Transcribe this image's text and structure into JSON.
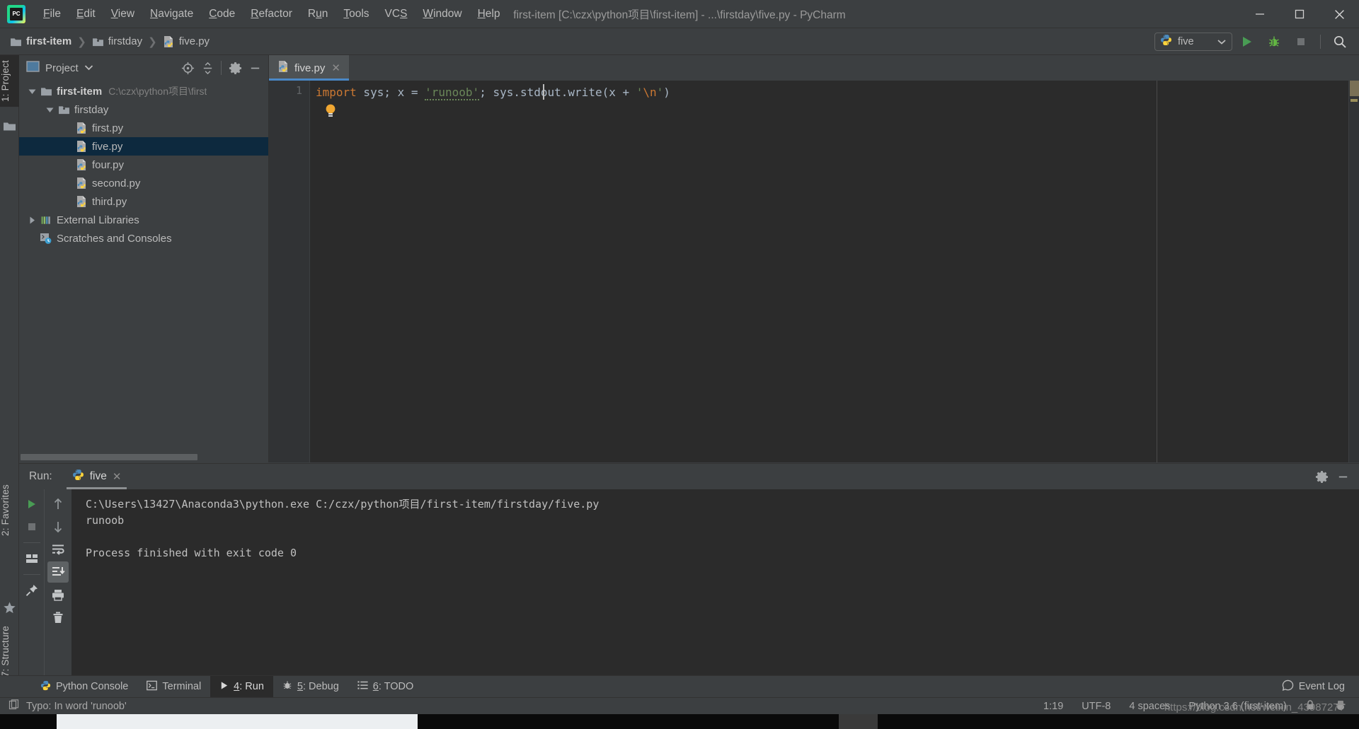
{
  "window": {
    "title": "first-item [C:\\czx\\python项目\\first-item] - ...\\firstday\\five.py - PyCharm",
    "minimize_label": "Minimize",
    "maximize_label": "Maximize",
    "close_label": "Close"
  },
  "menu": [
    {
      "label": "File",
      "mnemonic": "F"
    },
    {
      "label": "Edit",
      "mnemonic": "E"
    },
    {
      "label": "View",
      "mnemonic": "V"
    },
    {
      "label": "Navigate",
      "mnemonic": "N"
    },
    {
      "label": "Code",
      "mnemonic": "C"
    },
    {
      "label": "Refactor",
      "mnemonic": "R"
    },
    {
      "label": "Run",
      "mnemonic": "u"
    },
    {
      "label": "Tools",
      "mnemonic": "T"
    },
    {
      "label": "VCS",
      "mnemonic": "S"
    },
    {
      "label": "Window",
      "mnemonic": "W"
    },
    {
      "label": "Help",
      "mnemonic": "H"
    }
  ],
  "breadcrumbs": [
    {
      "label": "first-item",
      "icon": "folder-icon",
      "bold": true
    },
    {
      "label": "firstday",
      "icon": "folder-source-icon",
      "bold": false
    },
    {
      "label": "five.py",
      "icon": "python-file-icon",
      "bold": false
    }
  ],
  "toolbar": {
    "run_config": "five",
    "run_config_icon": "python-icon",
    "dropdown_icon": "chevron-down-icon",
    "run_button": "Run",
    "debug_button": "Debug",
    "stop_button": "Stop",
    "search_button": "Search Everywhere"
  },
  "left_strip": [
    {
      "label": "1: Project",
      "mnemonic": "1",
      "active": true,
      "icon": "project-icon"
    },
    {
      "label": "2: Favorites",
      "mnemonic": "2",
      "active": false,
      "icon": "star-icon"
    },
    {
      "label": "7: Structure",
      "mnemonic": "7",
      "active": false,
      "icon": "structure-icon"
    }
  ],
  "project_panel": {
    "title": "Project",
    "title_icon": "project-window-icon",
    "dropdown_icon": "chevron-down-icon",
    "actions": [
      {
        "name": "locate-icon",
        "tooltip": "Select Opened File"
      },
      {
        "name": "collapse-all-icon",
        "tooltip": "Collapse All"
      },
      {
        "name": "gear-icon",
        "tooltip": "Settings"
      },
      {
        "name": "minimize-icon",
        "tooltip": "Hide"
      }
    ],
    "tree": [
      {
        "label": "first-item",
        "path": "C:\\czx\\python项目\\first",
        "icon": "folder-icon",
        "depth": 0,
        "expanded": true,
        "bold": true,
        "selected": false
      },
      {
        "label": "firstday",
        "icon": "folder-source-icon",
        "depth": 1,
        "expanded": true,
        "bold": false,
        "selected": false
      },
      {
        "label": "first.py",
        "icon": "python-file-icon",
        "depth": 2,
        "expanded": null,
        "bold": false,
        "selected": false
      },
      {
        "label": "five.py",
        "icon": "python-file-icon",
        "depth": 2,
        "expanded": null,
        "bold": false,
        "selected": true
      },
      {
        "label": "four.py",
        "icon": "python-file-icon",
        "depth": 2,
        "expanded": null,
        "bold": false,
        "selected": false
      },
      {
        "label": "second.py",
        "icon": "python-file-icon",
        "depth": 2,
        "expanded": null,
        "bold": false,
        "selected": false
      },
      {
        "label": "third.py",
        "icon": "python-file-icon",
        "depth": 2,
        "expanded": null,
        "bold": false,
        "selected": false
      },
      {
        "label": "External Libraries",
        "icon": "libraries-icon",
        "depth": 0,
        "expanded": false,
        "bold": false,
        "selected": false
      },
      {
        "label": "Scratches and Consoles",
        "icon": "scratches-icon",
        "depth": 0,
        "expanded": null,
        "bold": false,
        "selected": false
      }
    ]
  },
  "editor": {
    "tab": {
      "label": "five.py",
      "icon": "python-file-icon",
      "close_icon": "close-icon"
    },
    "line_number": "1",
    "code_tokens": [
      {
        "text": "import",
        "kind": "keyword"
      },
      {
        "text": " sys; x = ",
        "kind": "plain"
      },
      {
        "text": "'runoob'",
        "kind": "string-typo"
      },
      {
        "text": "; sys.stdout.write(x + ",
        "kind": "plain"
      },
      {
        "text": "'",
        "kind": "string"
      },
      {
        "text": "\\n",
        "kind": "escape"
      },
      {
        "text": "'",
        "kind": "string"
      },
      {
        "text": ")",
        "kind": "plain"
      }
    ],
    "code_plain": "import sys; x = 'runoob'; sys.stdout.write(x + '\\n')",
    "intention_icon": "lightbulb-icon"
  },
  "run_panel": {
    "label": "Run:",
    "tab": {
      "label": "five",
      "icon": "python-icon",
      "close_icon": "close-icon"
    },
    "header_actions": [
      {
        "name": "gear-icon",
        "tooltip": "Settings"
      },
      {
        "name": "minimize-icon",
        "tooltip": "Hide"
      }
    ],
    "left_actions": [
      {
        "name": "rerun-icon",
        "tooltip": "Rerun"
      },
      {
        "name": "stop-icon",
        "tooltip": "Stop"
      },
      {
        "name": "layout-icon",
        "tooltip": "Layout"
      },
      {
        "name": "pin-icon",
        "tooltip": "Pin Tab"
      }
    ],
    "right_actions": [
      {
        "name": "arrow-up-icon",
        "tooltip": "Up the Stack Trace"
      },
      {
        "name": "arrow-down-icon",
        "tooltip": "Down the Stack Trace"
      },
      {
        "name": "soft-wrap-icon",
        "tooltip": "Use Soft Wraps"
      },
      {
        "name": "scroll-to-end-icon",
        "tooltip": "Scroll to End",
        "active": true
      },
      {
        "name": "print-icon",
        "tooltip": "Print"
      },
      {
        "name": "trash-icon",
        "tooltip": "Clear All"
      }
    ],
    "console_lines": [
      "C:\\Users\\13427\\Anaconda3\\python.exe C:/czx/python项目/first-item/firstday/five.py",
      "runoob",
      "",
      "Process finished with exit code 0"
    ]
  },
  "bottom_tabs": [
    {
      "label": "Python Console",
      "icon": "python-icon",
      "active": false,
      "mnemonic": ""
    },
    {
      "label": "Terminal",
      "icon": "terminal-icon",
      "active": false,
      "mnemonic": ""
    },
    {
      "label": "4: Run",
      "icon": "play-icon",
      "active": true,
      "mnemonic": "4"
    },
    {
      "label": "5: Debug",
      "icon": "bug-icon",
      "active": false,
      "mnemonic": "5"
    },
    {
      "label": "6: TODO",
      "icon": "todo-icon",
      "active": false,
      "mnemonic": "6"
    }
  ],
  "event_log": {
    "label": "Event Log",
    "icon": "event-log-icon"
  },
  "status_bar": {
    "message": "Typo: In word 'runoob'",
    "message_icon": "inspection-icon",
    "caret_position": "1:19",
    "encoding": "UTF-8",
    "indent": "4 spaces",
    "interpreter": "Python 3.6 (first-item)",
    "lock_icon": "lock-icon",
    "hat_icon": "hector-icon"
  },
  "watermark": "https://blog.csdn.net/weixin_43987277",
  "colors": {
    "background": "#3c3f41",
    "editor_background": "#2b2b2b",
    "accent_blue": "#4a88c7",
    "selection": "#0d293e",
    "keyword": "#cc7832",
    "string": "#6a8759",
    "plain_code": "#a9b7c6",
    "run_green": "#499c54",
    "warning_marker": "#7a7055"
  }
}
